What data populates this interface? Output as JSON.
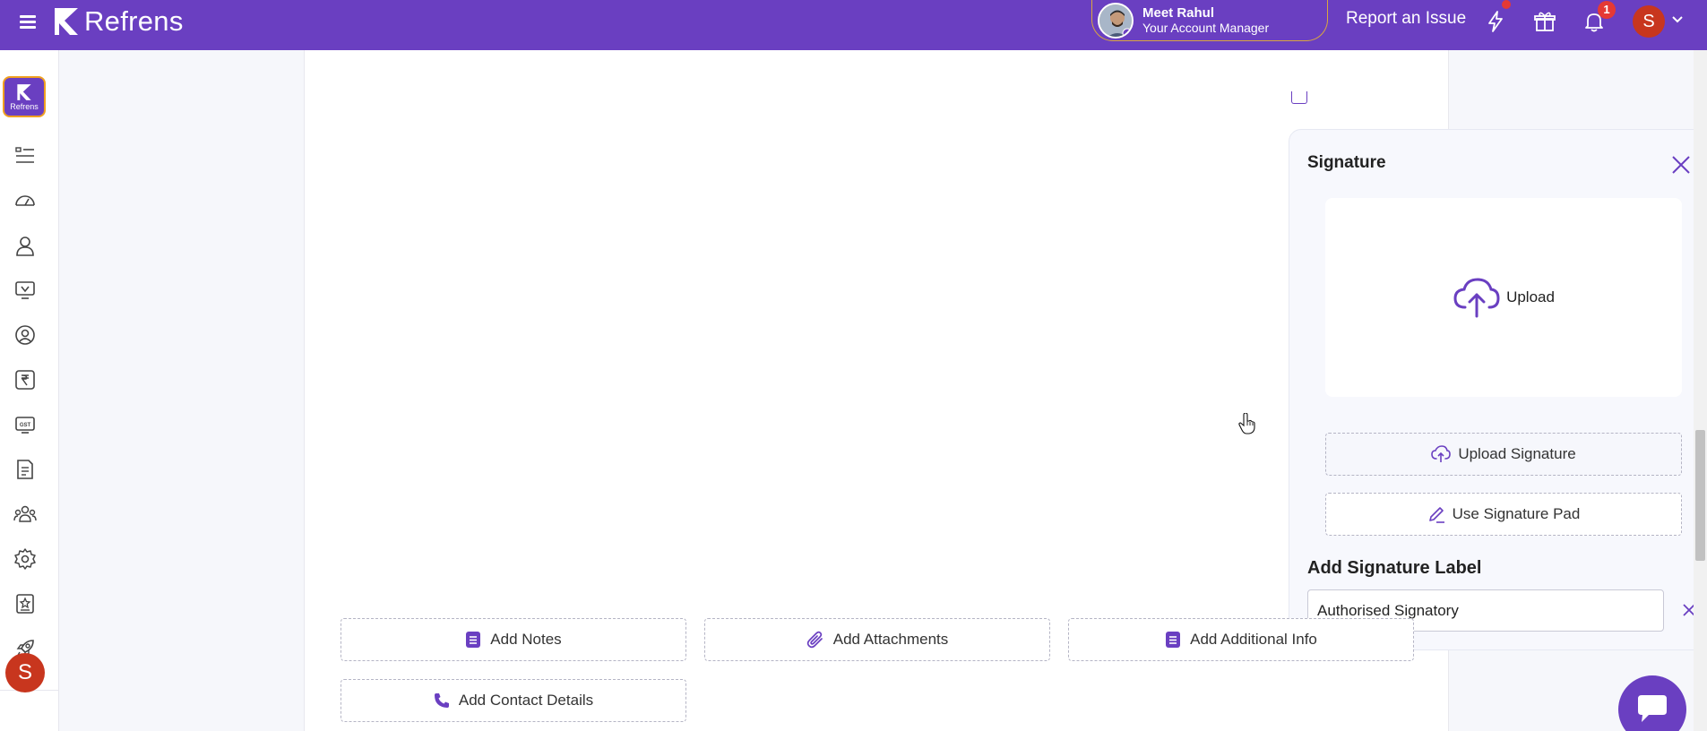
{
  "topbar": {
    "logo_text": "Refrens",
    "manager_name": "Meet Rahul",
    "manager_role": "Your Account Manager",
    "report_label": "Report an Issue",
    "notification_count": "1",
    "user_initial": "S"
  },
  "sidebar": {
    "logo_label": "Refrens",
    "items": [
      "list-icon",
      "dashboard-icon",
      "user-icon",
      "sales-icon",
      "contact-icon",
      "rupee-icon",
      "gst-icon",
      "document-icon",
      "team-icon",
      "settings-icon",
      "badge-icon",
      "rocket-icon"
    ],
    "user_initial": "S"
  },
  "signature": {
    "title": "Signature",
    "upload_label": "Upload",
    "upload_signature_label": "Upload Signature",
    "signature_pad_label": "Use Signature Pad",
    "label_title": "Add Signature Label",
    "label_value": "Authorised Signatory"
  },
  "actions": {
    "add_notes": "Add Notes",
    "add_attachments": "Add Attachments",
    "add_additional_info": "Add Additional Info",
    "add_contact_details": "Add Contact Details"
  },
  "colors": {
    "brand": "#6a3fc1",
    "accent_border": "#d9a640",
    "alert": "#e53935"
  }
}
